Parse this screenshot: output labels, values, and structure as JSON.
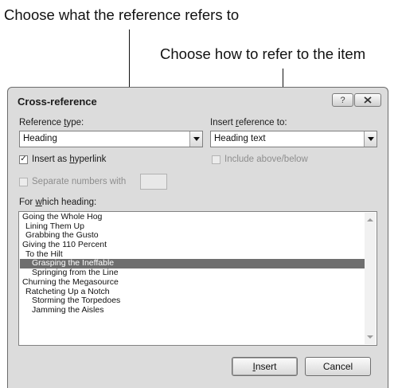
{
  "callouts": {
    "reference_callout": "Choose what the reference refers to",
    "refer_callout": "Choose how to refer to the item"
  },
  "dialog": {
    "title": "Cross-reference",
    "help_icon_text": "?",
    "reference_type": {
      "label_before": "Reference ",
      "label_mnemonic": "t",
      "label_after": "ype:",
      "value": "Heading"
    },
    "insert_reference_to": {
      "label_before": "Insert ",
      "label_mnemonic": "r",
      "label_after": "eference to:",
      "value": "Heading text"
    },
    "insert_as_hyperlink": {
      "label_before": "Insert as ",
      "label_mnemonic": "h",
      "label_after": "yperlink",
      "checked": true
    },
    "include_above_below": {
      "label": "Include above/below",
      "checked": false,
      "disabled": true
    },
    "separate_numbers": {
      "label": "Separate numbers with",
      "checked": false,
      "disabled": true,
      "value": ""
    },
    "for_which": {
      "label_before": "For ",
      "label_mnemonic": "w",
      "label_after": "hich heading:"
    },
    "headings": [
      {
        "text": "Going the Whole Hog",
        "level": 1
      },
      {
        "text": "Lining Them Up",
        "level": 2
      },
      {
        "text": "Grabbing the Gusto",
        "level": 2
      },
      {
        "text": "Giving the 110 Percent",
        "level": 1
      },
      {
        "text": "To the Hilt",
        "level": 2
      },
      {
        "text": "Grasping the Ineffable",
        "level": 3,
        "selected": true
      },
      {
        "text": "Springing from the Line",
        "level": 3
      },
      {
        "text": "Churning the Megasource",
        "level": 1
      },
      {
        "text": "Ratcheting Up a Notch",
        "level": 2
      },
      {
        "text": "Storming the Torpedoes",
        "level": 3
      },
      {
        "text": "Jamming the Aisles",
        "level": 3
      }
    ],
    "insert_button": {
      "mnemonic": "I",
      "rest": "nsert"
    },
    "cancel_button": {
      "label": "Cancel"
    },
    "icons": {
      "help": "help-icon",
      "close": "close-icon",
      "dropdown": "chevron-down-icon",
      "check": "checkmark-icon",
      "scroll_up": "scroll-up-arrow-icon",
      "scroll_down": "scroll-down-arrow-icon"
    }
  }
}
